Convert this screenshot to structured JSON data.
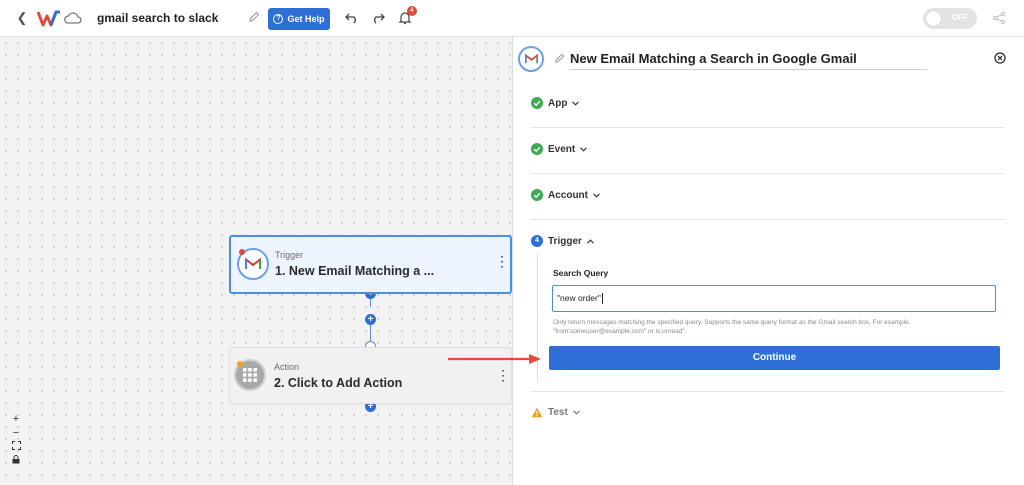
{
  "topbar": {
    "title": "gmail search to slack",
    "help_label": "Get Help",
    "help_icon": "question-circle-icon",
    "notification_count": "4",
    "toggle_label": "OFF",
    "toggle_on": false
  },
  "canvas": {
    "trigger_node": {
      "sub_label": "Trigger",
      "title": "1. New Email Matching a ...",
      "status_dot_color": "#e0483a"
    },
    "action_node": {
      "sub_label": "Action",
      "title": "2. Click to Add Action",
      "status_dot_color": "#f0a020"
    },
    "zoom_controls": [
      "+",
      "−"
    ]
  },
  "panel": {
    "title": "New Email Matching a Search in Google Gmail",
    "sections": [
      {
        "label": "App",
        "status": "complete"
      },
      {
        "label": "Event",
        "status": "complete"
      },
      {
        "label": "Account",
        "status": "complete"
      },
      {
        "label": "Trigger",
        "status": "active",
        "step_number": "4"
      }
    ],
    "trigger": {
      "field_label": "Search Query",
      "field_value": "\"new order\"",
      "help_text": "Only return messages matching the specified query. Supports the same query format as the Gmail search box. For example, \"from:someuser@example.com\" or is:unread\".",
      "continue_label": "Continue"
    },
    "test_section": {
      "label": "Test",
      "status": "warning"
    }
  },
  "colors": {
    "accent": "#2d6fd6",
    "success": "#3cab54",
    "warning": "#f0a020",
    "arrow": "#e04b3a"
  }
}
